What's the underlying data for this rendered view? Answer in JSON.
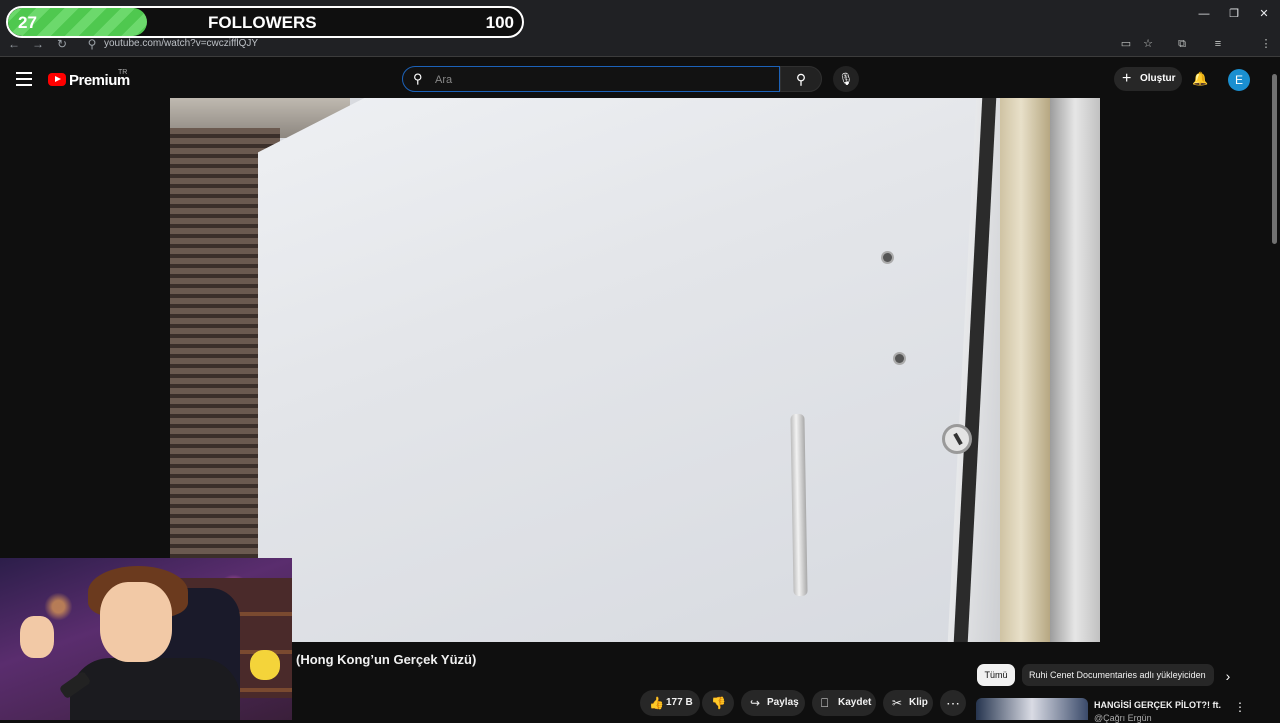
{
  "browser": {
    "url": "youtube.com/watch?v=cwczifflQJY",
    "account_initial": "E"
  },
  "followers_overlay": {
    "current": "27",
    "label": "FOLLOWERS",
    "goal": "100",
    "progress_fraction": 0.27
  },
  "header": {
    "logo_text": "Premium",
    "region": "TR",
    "search_placeholder": "Ara",
    "create_label": "Oluştur",
    "avatar_initial": "E"
  },
  "video": {
    "title": "(Hong Kong’un Gerçek Yüzü)"
  },
  "actions": {
    "like_count": "177 B",
    "share_label": "Paylaş",
    "save_label": "Kaydet",
    "clip_label": "Klip"
  },
  "chips": {
    "all_label": "Tümü",
    "channel_chip": "Ruhi Cenet Documentaries adlı yükleyiciden"
  },
  "recommendation": {
    "title": "HANGİSİ GERÇEK PİLOT?! ft.",
    "channel": "@Çağrı Ergün"
  },
  "icons": {
    "like": "thumbs-up-icon",
    "dislike": "thumbs-down-icon",
    "share": "share-icon",
    "save": "bookmark-icon",
    "clip": "scissors-icon"
  },
  "colors": {
    "accent": "#ff0000",
    "search_border": "#1c62b9",
    "follow_bar": "#5fd05f"
  }
}
